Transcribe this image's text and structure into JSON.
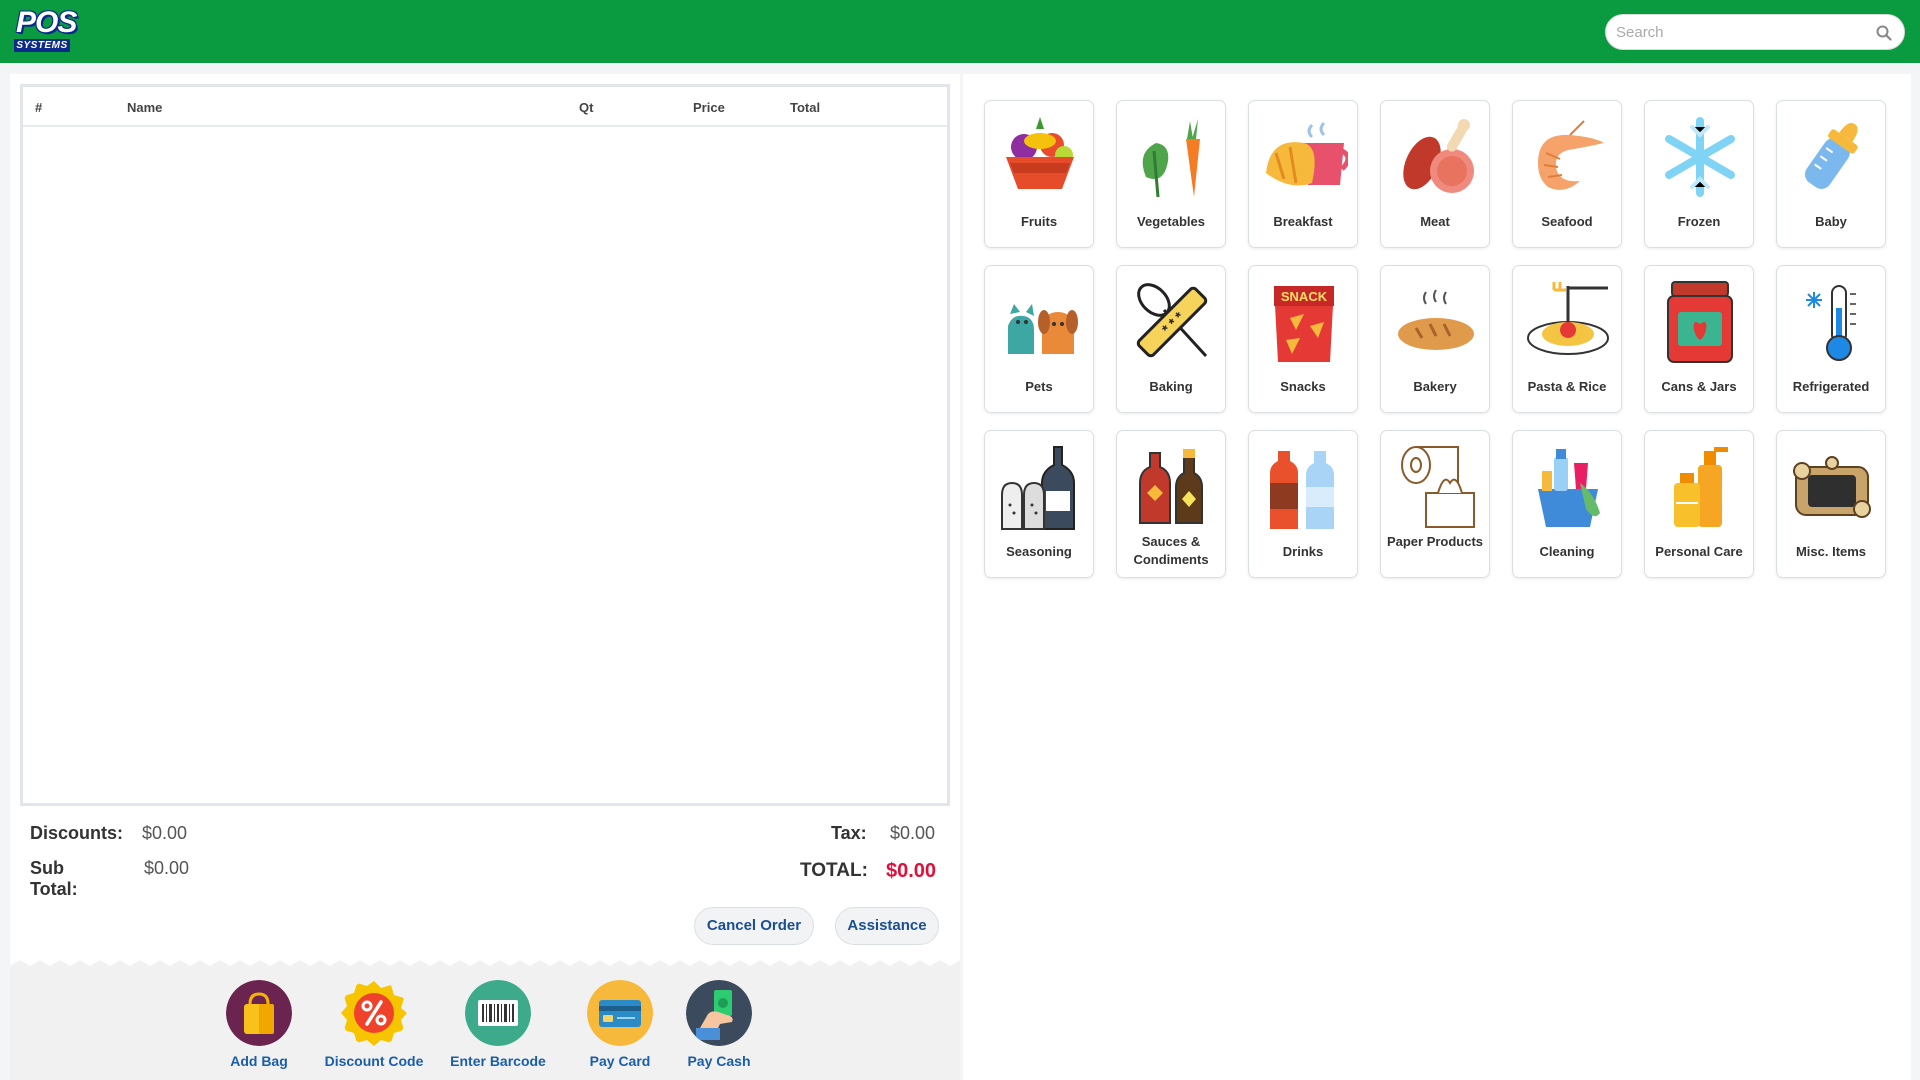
{
  "header": {
    "logo_top": "POS",
    "logo_bottom": "SYSTEMS",
    "search_placeholder": "Search",
    "search_icon": "magnifier-icon",
    "bar_color": "#0a9a3f"
  },
  "order_table": {
    "columns": [
      "#",
      "Name",
      "Qt",
      "Price",
      "Total"
    ],
    "rows": []
  },
  "summary": {
    "discounts_label": "Discounts:",
    "discounts_value": "$0.00",
    "subtotal_label": "Sub Total:",
    "subtotal_value": "$0.00",
    "tax_label": "Tax:",
    "tax_value": "$0.00",
    "total_label": "TOTAL:",
    "total_value": "$0.00",
    "total_color": "#e0103b"
  },
  "buttons": {
    "cancel_order": "Cancel Order",
    "assistance": "Assistance"
  },
  "actions": [
    {
      "label": "Add Bag",
      "icon": "shopping-bag-icon"
    },
    {
      "label": "Discount Code",
      "icon": "percent-badge-icon"
    },
    {
      "label": "Enter Barcode",
      "icon": "barcode-icon"
    },
    {
      "label": "Pay Card",
      "icon": "credit-card-icon"
    },
    {
      "label": "Pay Cash",
      "icon": "cash-hand-icon"
    }
  ],
  "categories": [
    {
      "label": "Fruits",
      "icon": "fruit-basket-icon"
    },
    {
      "label": "Vegetables",
      "icon": "vegetables-icon"
    },
    {
      "label": "Breakfast",
      "icon": "croissant-coffee-icon"
    },
    {
      "label": "Meat",
      "icon": "meat-icon"
    },
    {
      "label": "Seafood",
      "icon": "shrimp-icon"
    },
    {
      "label": "Frozen",
      "icon": "snowflake-icon"
    },
    {
      "label": "Baby",
      "icon": "baby-bottle-icon"
    },
    {
      "label": "Pets",
      "icon": "cat-dog-icon"
    },
    {
      "label": "Baking",
      "icon": "whisk-rolling-pin-icon"
    },
    {
      "label": "Snacks",
      "icon": "snack-bag-icon",
      "icon_text": "SNACK"
    },
    {
      "label": "Bakery",
      "icon": "bread-icon"
    },
    {
      "label": "Pasta & Rice",
      "icon": "pasta-plate-icon"
    },
    {
      "label": "Cans & Jars",
      "icon": "jam-jar-icon"
    },
    {
      "label": "Refrigerated",
      "icon": "thermometer-icon"
    },
    {
      "label": "Seasoning",
      "icon": "salt-pepper-bottle-icon"
    },
    {
      "label": "Sauces & Condiments",
      "icon": "sauce-bottles-icon"
    },
    {
      "label": "Drinks",
      "icon": "drink-bottles-icon"
    },
    {
      "label": "Paper Products",
      "icon": "paper-towel-tissue-icon"
    },
    {
      "label": "Cleaning",
      "icon": "cleaning-bucket-icon"
    },
    {
      "label": "Personal Care",
      "icon": "lotion-bottles-icon"
    },
    {
      "label": "Misc. Items",
      "icon": "misc-board-icon"
    }
  ]
}
